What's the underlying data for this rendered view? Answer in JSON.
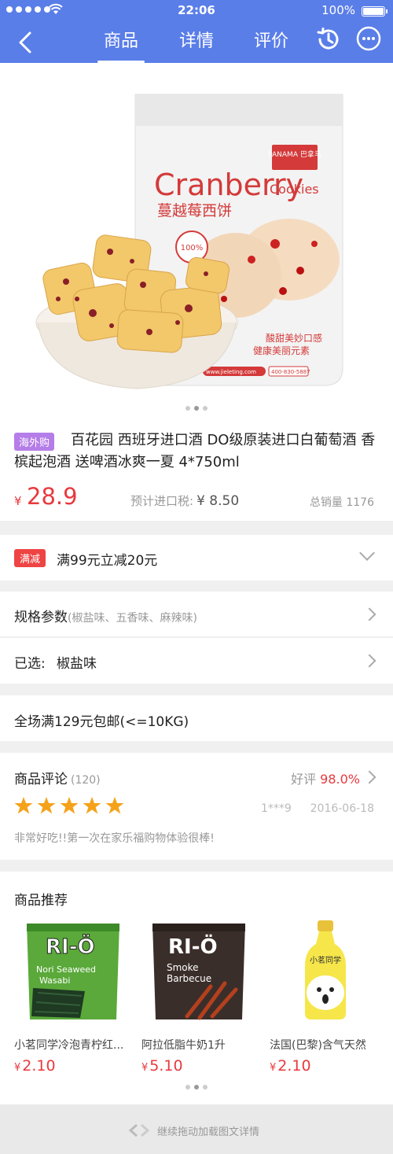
{
  "status_bar": {
    "time": "22:06",
    "battery": "100%"
  },
  "nav": {
    "tabs": [
      "商品",
      "详情",
      "评价"
    ],
    "active_tab": "商品"
  },
  "product": {
    "image_caption_brand": "PANAMA 巴拿马",
    "image_title_en": "Cranberry",
    "image_title_en2": "Cookies",
    "image_title_cn": "蔓越莓西饼",
    "image_tagline1": "酸甜美妙口感",
    "image_tagline2": "健康美丽元素",
    "image_site": "www.jieleting.com",
    "image_phone": "400-830-5887",
    "image_badge": "100%",
    "overseas_tag": "海外购",
    "title": "百花园 西班牙进口酒 DO级原装进口白葡萄酒 香槟起泡酒 送啤酒冰爽一夏 4*750ml",
    "currency": "¥",
    "price": "28.9",
    "tax_label": "预计进口税:",
    "tax_value": "¥ 8.50",
    "sales": "总销量 1176"
  },
  "promo": {
    "tag": "满减",
    "text": "满99元立减20元"
  },
  "spec": {
    "label": "规格参数",
    "options": "(椒盐味、五香味、麻辣味)"
  },
  "selected": {
    "label": "已选:",
    "value": "椒盐味"
  },
  "shipping": {
    "text": "全场满129元包邮(<=10KG)"
  },
  "reviews": {
    "title": "商品评论",
    "count": "(120)",
    "good_label": "好评",
    "good_rate": "98.0%",
    "stars": 5,
    "user": "1***9",
    "date": "2016-06-18",
    "content": "非常好吃!!第一次在家乐福购物体验很棒!"
  },
  "recommend": {
    "title": "商品推荐",
    "items": [
      {
        "name": "小茗同学冷泡青柠红...",
        "currency": "¥",
        "price": "2.10",
        "pack_brand": "RI-Ö",
        "pack_line1": "Nori Seaweed",
        "pack_line2": "Wasabi"
      },
      {
        "name": "阿拉低脂牛奶1升",
        "currency": "¥",
        "price": "5.10",
        "pack_brand": "RI-Ö",
        "pack_line1": "Smoke",
        "pack_line2": "Barbecue"
      },
      {
        "name": "法国(巴黎)含气天然",
        "currency": "¥",
        "price": "2.10",
        "pack_brand": "小茗同学"
      }
    ]
  },
  "footer": {
    "text": "继续拖动加载图文详情"
  },
  "colors": {
    "nav_bg": "#5a7ee8",
    "price": "#e8393e",
    "overseas_tag": "#b57de8",
    "promo_tag": "#ee4444",
    "star": "#f5a21b"
  }
}
